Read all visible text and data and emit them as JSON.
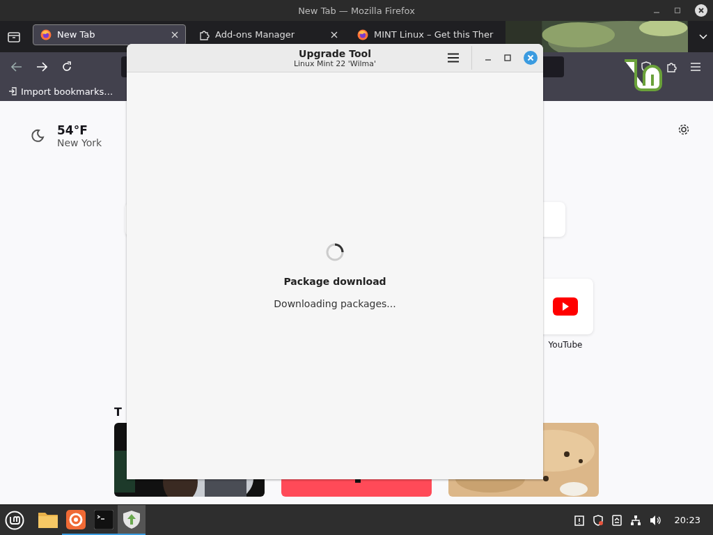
{
  "firefox": {
    "title": "New Tab — Mozilla Firefox",
    "tabs": [
      {
        "label": "New Tab",
        "selected": true,
        "closable": true
      },
      {
        "label": "Add-ons Manager",
        "selected": false,
        "closable": true
      },
      {
        "label": "MINT Linux – Get this Ther",
        "selected": false,
        "closable": false
      }
    ],
    "bookmarks": [
      {
        "label": "Import bookmarks…"
      }
    ],
    "weather": {
      "temperature": "54°F",
      "location": "New York"
    },
    "shortcuts": [
      {
        "label": "YouTube"
      }
    ],
    "stories_heading": "T"
  },
  "dialog": {
    "title": "Upgrade Tool",
    "subtitle": "Linux Mint 22 'Wilma'",
    "heading": "Package download",
    "status": "Downloading packages..."
  },
  "taskbar": {
    "apps": [
      {
        "kind": "folder",
        "running": false,
        "selected": false
      },
      {
        "kind": "firefox",
        "running": true,
        "selected": false
      },
      {
        "kind": "terminal",
        "running": true,
        "selected": false
      },
      {
        "kind": "upgrade",
        "running": true,
        "selected": true
      }
    ],
    "clock": "20:23"
  }
}
